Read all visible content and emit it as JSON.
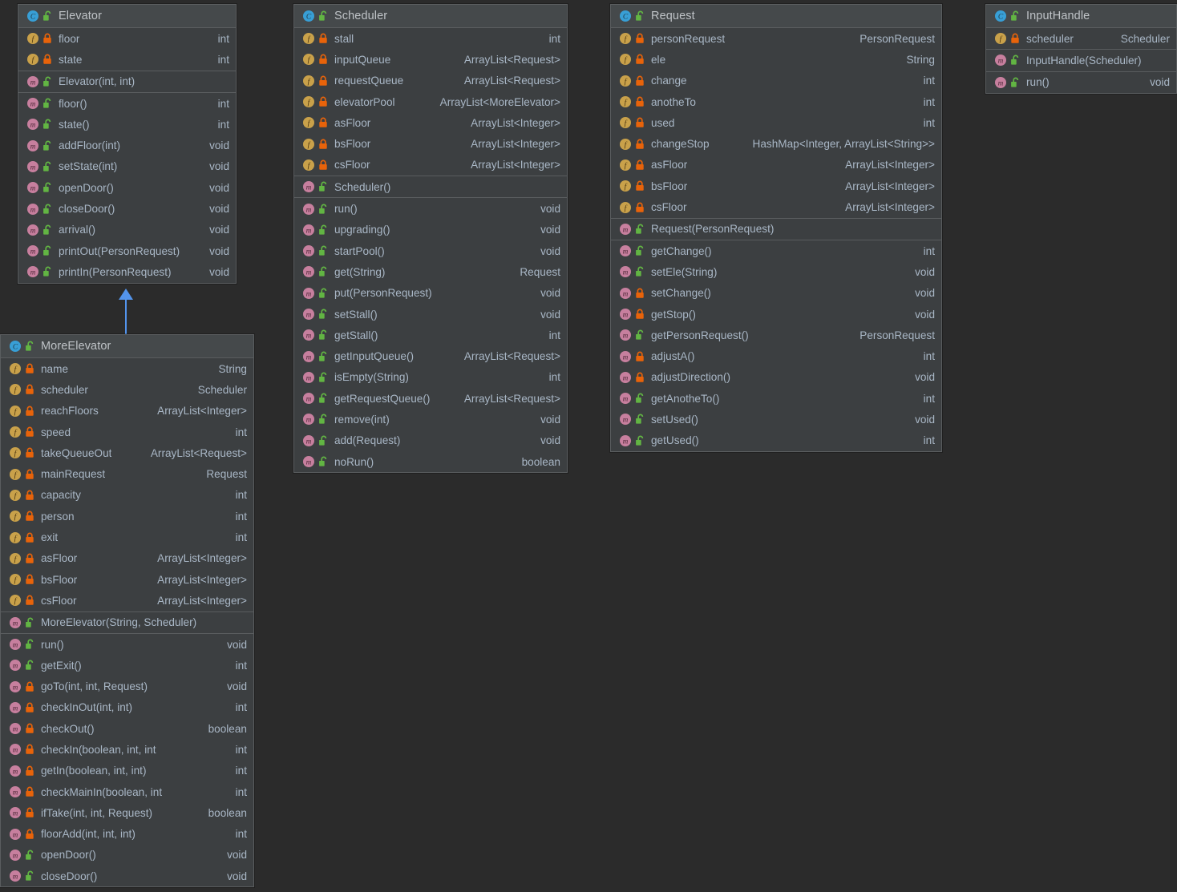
{
  "diagram": {
    "title": "UML Class Diagram",
    "colors": {
      "canvas_bg": "#2b2b2b",
      "box_bg": "#3c3f41",
      "header_bg": "#45494b",
      "border": "#5a5d5f",
      "text": "#a9b7c6",
      "class_icon": "#389fd6",
      "field_icon": "#c9a14a",
      "method_icon": "#c77f9e",
      "public_lock": "#62b543",
      "private_lock": "#e8630a",
      "relation_arrow": "#5394ec"
    },
    "icon_names": {
      "class": "class-icon",
      "field": "field-icon",
      "method": "method-icon",
      "public": "public-unlocked-icon",
      "private": "private-locked-icon"
    },
    "relations": [
      {
        "name": "inheritance-arrow",
        "type": "generalization",
        "from": "MoreElevator",
        "to": "Elevator"
      }
    ],
    "classes": [
      {
        "name": "Elevator",
        "visibility": "public",
        "sections": [
          {
            "kind": "fields",
            "members": [
              {
                "icon": "field",
                "visibility": "private",
                "name": "floor",
                "type": "int"
              },
              {
                "icon": "field",
                "visibility": "private",
                "name": "state",
                "type": "int"
              }
            ]
          },
          {
            "kind": "constructors",
            "members": [
              {
                "icon": "method",
                "visibility": "public",
                "name": "Elevator(int, int)",
                "type": ""
              }
            ]
          },
          {
            "kind": "methods",
            "members": [
              {
                "icon": "method",
                "visibility": "public",
                "name": "floor()",
                "type": "int"
              },
              {
                "icon": "method",
                "visibility": "public",
                "name": "state()",
                "type": "int"
              },
              {
                "icon": "method",
                "visibility": "public",
                "name": "addFloor(int)",
                "type": "void"
              },
              {
                "icon": "method",
                "visibility": "public",
                "name": "setState(int)",
                "type": "void"
              },
              {
                "icon": "method",
                "visibility": "public",
                "name": "openDoor()",
                "type": "void"
              },
              {
                "icon": "method",
                "visibility": "public",
                "name": "closeDoor()",
                "type": "void"
              },
              {
                "icon": "method",
                "visibility": "public",
                "name": "arrival()",
                "type": "void"
              },
              {
                "icon": "method",
                "visibility": "public",
                "name": "printOut(PersonRequest)",
                "type": "void"
              },
              {
                "icon": "method",
                "visibility": "public",
                "name": "printIn(PersonRequest)",
                "type": "void"
              }
            ]
          }
        ]
      },
      {
        "name": "MoreElevator",
        "visibility": "public",
        "sections": [
          {
            "kind": "fields",
            "members": [
              {
                "icon": "field",
                "visibility": "private",
                "name": "name",
                "type": "String"
              },
              {
                "icon": "field",
                "visibility": "private",
                "name": "scheduler",
                "type": "Scheduler"
              },
              {
                "icon": "field",
                "visibility": "private",
                "name": "reachFloors",
                "type": "ArrayList<Integer>"
              },
              {
                "icon": "field",
                "visibility": "private",
                "name": "speed",
                "type": "int"
              },
              {
                "icon": "field",
                "visibility": "private",
                "name": "takeQueueOut",
                "type": "ArrayList<Request>"
              },
              {
                "icon": "field",
                "visibility": "private",
                "name": "mainRequest",
                "type": "Request"
              },
              {
                "icon": "field",
                "visibility": "private",
                "name": "capacity",
                "type": "int"
              },
              {
                "icon": "field",
                "visibility": "private",
                "name": "person",
                "type": "int"
              },
              {
                "icon": "field",
                "visibility": "private",
                "name": "exit",
                "type": "int"
              },
              {
                "icon": "field",
                "visibility": "private",
                "name": "asFloor",
                "type": "ArrayList<Integer>"
              },
              {
                "icon": "field",
                "visibility": "private",
                "name": "bsFloor",
                "type": "ArrayList<Integer>"
              },
              {
                "icon": "field",
                "visibility": "private",
                "name": "csFloor",
                "type": "ArrayList<Integer>"
              }
            ]
          },
          {
            "kind": "constructors",
            "members": [
              {
                "icon": "method",
                "visibility": "public",
                "name": "MoreElevator(String, Scheduler)",
                "type": ""
              }
            ]
          },
          {
            "kind": "methods",
            "members": [
              {
                "icon": "method",
                "visibility": "public",
                "name": "run()",
                "type": "void"
              },
              {
                "icon": "method",
                "visibility": "public",
                "name": "getExit()",
                "type": "int"
              },
              {
                "icon": "method",
                "visibility": "private",
                "name": "goTo(int, int, Request)",
                "type": "void"
              },
              {
                "icon": "method",
                "visibility": "private",
                "name": "checkInOut(int, int)",
                "type": "int"
              },
              {
                "icon": "method",
                "visibility": "private",
                "name": "checkOut()",
                "type": "boolean"
              },
              {
                "icon": "method",
                "visibility": "private",
                "name": "checkIn(boolean, int, int",
                "type": "int"
              },
              {
                "icon": "method",
                "visibility": "private",
                "name": "getIn(boolean, int, int)",
                "type": "int"
              },
              {
                "icon": "method",
                "visibility": "private",
                "name": "checkMainIn(boolean, int",
                "type": "int"
              },
              {
                "icon": "method",
                "visibility": "private",
                "name": "ifTake(int, int, Request)",
                "type": "boolean"
              },
              {
                "icon": "method",
                "visibility": "private",
                "name": "floorAdd(int, int, int)",
                "type": "int"
              },
              {
                "icon": "method",
                "visibility": "public",
                "name": "openDoor()",
                "type": "void"
              },
              {
                "icon": "method",
                "visibility": "public",
                "name": "closeDoor()",
                "type": "void"
              }
            ]
          }
        ]
      },
      {
        "name": "Scheduler",
        "visibility": "public",
        "sections": [
          {
            "kind": "fields",
            "members": [
              {
                "icon": "field",
                "visibility": "private",
                "name": "stall",
                "type": "int"
              },
              {
                "icon": "field",
                "visibility": "private",
                "name": "inputQueue",
                "type": "ArrayList<Request>"
              },
              {
                "icon": "field",
                "visibility": "private",
                "name": "requestQueue",
                "type": "ArrayList<Request>"
              },
              {
                "icon": "field",
                "visibility": "private",
                "name": "elevatorPool",
                "type": "ArrayList<MoreElevator>"
              },
              {
                "icon": "field",
                "visibility": "private",
                "name": "asFloor",
                "type": "ArrayList<Integer>"
              },
              {
                "icon": "field",
                "visibility": "private",
                "name": "bsFloor",
                "type": "ArrayList<Integer>"
              },
              {
                "icon": "field",
                "visibility": "private",
                "name": "csFloor",
                "type": "ArrayList<Integer>"
              }
            ]
          },
          {
            "kind": "constructors",
            "members": [
              {
                "icon": "method",
                "visibility": "public",
                "name": "Scheduler()",
                "type": ""
              }
            ]
          },
          {
            "kind": "methods",
            "members": [
              {
                "icon": "method",
                "visibility": "public",
                "name": "run()",
                "type": "void"
              },
              {
                "icon": "method",
                "visibility": "public",
                "name": "upgrading()",
                "type": "void"
              },
              {
                "icon": "method",
                "visibility": "public",
                "name": "startPool()",
                "type": "void"
              },
              {
                "icon": "method",
                "visibility": "public",
                "name": "get(String)",
                "type": "Request"
              },
              {
                "icon": "method",
                "visibility": "public",
                "name": "put(PersonRequest)",
                "type": "void"
              },
              {
                "icon": "method",
                "visibility": "public",
                "name": "setStall()",
                "type": "void"
              },
              {
                "icon": "method",
                "visibility": "public",
                "name": "getStall()",
                "type": "int"
              },
              {
                "icon": "method",
                "visibility": "public",
                "name": "getInputQueue()",
                "type": "ArrayList<Request>"
              },
              {
                "icon": "method",
                "visibility": "public",
                "name": "isEmpty(String)",
                "type": "int"
              },
              {
                "icon": "method",
                "visibility": "public",
                "name": "getRequestQueue()",
                "type": "ArrayList<Request>"
              },
              {
                "icon": "method",
                "visibility": "public",
                "name": "remove(int)",
                "type": "void"
              },
              {
                "icon": "method",
                "visibility": "public",
                "name": "add(Request)",
                "type": "void"
              },
              {
                "icon": "method",
                "visibility": "public",
                "name": "noRun()",
                "type": "boolean"
              }
            ]
          }
        ]
      },
      {
        "name": "Request",
        "visibility": "public",
        "sections": [
          {
            "kind": "fields",
            "members": [
              {
                "icon": "field",
                "visibility": "private",
                "name": "personRequest",
                "type": "PersonRequest"
              },
              {
                "icon": "field",
                "visibility": "private",
                "name": "ele",
                "type": "String"
              },
              {
                "icon": "field",
                "visibility": "private",
                "name": "change",
                "type": "int"
              },
              {
                "icon": "field",
                "visibility": "private",
                "name": "anotheTo",
                "type": "int"
              },
              {
                "icon": "field",
                "visibility": "private",
                "name": "used",
                "type": "int"
              },
              {
                "icon": "field",
                "visibility": "private",
                "name": "changeStop",
                "type": "HashMap<Integer, ArrayList<String>>"
              },
              {
                "icon": "field",
                "visibility": "private",
                "name": "asFloor",
                "type": "ArrayList<Integer>"
              },
              {
                "icon": "field",
                "visibility": "private",
                "name": "bsFloor",
                "type": "ArrayList<Integer>"
              },
              {
                "icon": "field",
                "visibility": "private",
                "name": "csFloor",
                "type": "ArrayList<Integer>"
              }
            ]
          },
          {
            "kind": "constructors",
            "members": [
              {
                "icon": "method",
                "visibility": "public",
                "name": "Request(PersonRequest)",
                "type": ""
              }
            ]
          },
          {
            "kind": "methods",
            "members": [
              {
                "icon": "method",
                "visibility": "public",
                "name": "getChange()",
                "type": "int"
              },
              {
                "icon": "method",
                "visibility": "public",
                "name": "setEle(String)",
                "type": "void"
              },
              {
                "icon": "method",
                "visibility": "private",
                "name": "setChange()",
                "type": "void"
              },
              {
                "icon": "method",
                "visibility": "private",
                "name": "getStop()",
                "type": "void"
              },
              {
                "icon": "method",
                "visibility": "public",
                "name": "getPersonRequest()",
                "type": "PersonRequest"
              },
              {
                "icon": "method",
                "visibility": "private",
                "name": "adjustA()",
                "type": "int"
              },
              {
                "icon": "method",
                "visibility": "private",
                "name": "adjustDirection()",
                "type": "void"
              },
              {
                "icon": "method",
                "visibility": "public",
                "name": "getAnotheTo()",
                "type": "int"
              },
              {
                "icon": "method",
                "visibility": "public",
                "name": "setUsed()",
                "type": "void"
              },
              {
                "icon": "method",
                "visibility": "public",
                "name": "getUsed()",
                "type": "int"
              }
            ]
          }
        ]
      },
      {
        "name": "InputHandle",
        "visibility": "public",
        "sections": [
          {
            "kind": "fields",
            "members": [
              {
                "icon": "field",
                "visibility": "private",
                "name": "scheduler",
                "type": "Scheduler"
              }
            ]
          },
          {
            "kind": "constructors",
            "members": [
              {
                "icon": "method",
                "visibility": "public",
                "name": "InputHandle(Scheduler)",
                "type": ""
              }
            ]
          },
          {
            "kind": "methods",
            "members": [
              {
                "icon": "method",
                "visibility": "public",
                "name": "run()",
                "type": "void"
              }
            ]
          }
        ]
      }
    ]
  }
}
